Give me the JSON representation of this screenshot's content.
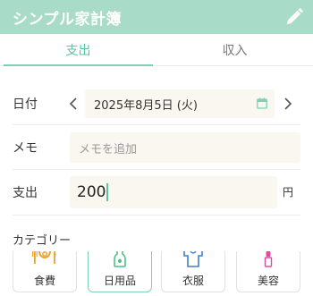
{
  "header": {
    "title": "シンプル家計簿",
    "edit_icon": "pencil-icon"
  },
  "tabs": [
    {
      "label": "支出",
      "active": true
    },
    {
      "label": "収入",
      "active": false
    }
  ],
  "form": {
    "date": {
      "label": "日付",
      "value": "2025年8月5日 (火)",
      "prev_icon": "chevron-left-icon",
      "next_icon": "chevron-right-icon",
      "calendar_icon": "calendar-icon"
    },
    "memo": {
      "label": "メモ",
      "placeholder": "メモを追加",
      "value": ""
    },
    "amount": {
      "label": "支出",
      "value": "200",
      "unit": "円"
    }
  },
  "category": {
    "label": "カテゴリー",
    "items": [
      {
        "name": "食費",
        "icon": "food-plate-icon",
        "color": "#f0a030",
        "selected": false
      },
      {
        "name": "日用品",
        "icon": "detergent-bottle-icon",
        "color": "#4cbf85",
        "selected": true
      },
      {
        "name": "衣服",
        "icon": "shirt-icon",
        "color": "#3f7fd0",
        "selected": false
      },
      {
        "name": "美容",
        "icon": "lipstick-icon",
        "color": "#e04aa0",
        "selected": false
      }
    ]
  },
  "colors": {
    "accent": "#5cc3a3",
    "header_bg": "#a8dcc9",
    "input_bg": "#f9f7ef"
  }
}
